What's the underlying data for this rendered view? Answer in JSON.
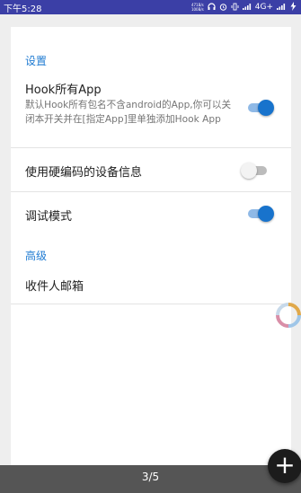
{
  "status_bar": {
    "time": "下午5:28",
    "net_speed_top": "471B/s",
    "net_speed_bottom": "100B/s",
    "network": "4G+",
    "icons": [
      "headphones-icon",
      "alarm-icon",
      "vibrate-icon",
      "signal-icon",
      "battery-icon"
    ]
  },
  "settings": {
    "section_settings": "设置",
    "hook_all": {
      "title": "Hook所有App",
      "summary": "默认Hook所有包名不含android的App,你可以关闭本开关并在[指定App]里单独添加Hook App",
      "enabled": true
    },
    "hardcoded_device": {
      "title": "使用硬编码的设备信息",
      "enabled": false
    },
    "debug_mode": {
      "title": "调试模式",
      "enabled": true
    },
    "section_advanced": "高级",
    "recipient_email": {
      "title": "收件人邮箱"
    }
  },
  "pager": {
    "counter": "3/5"
  },
  "fab": {
    "label": "+",
    "icon": "plus-icon"
  },
  "colors": {
    "accent": "#1873cc",
    "status_bar": "#3b3fa6",
    "section_header": "#1f7bd2"
  }
}
